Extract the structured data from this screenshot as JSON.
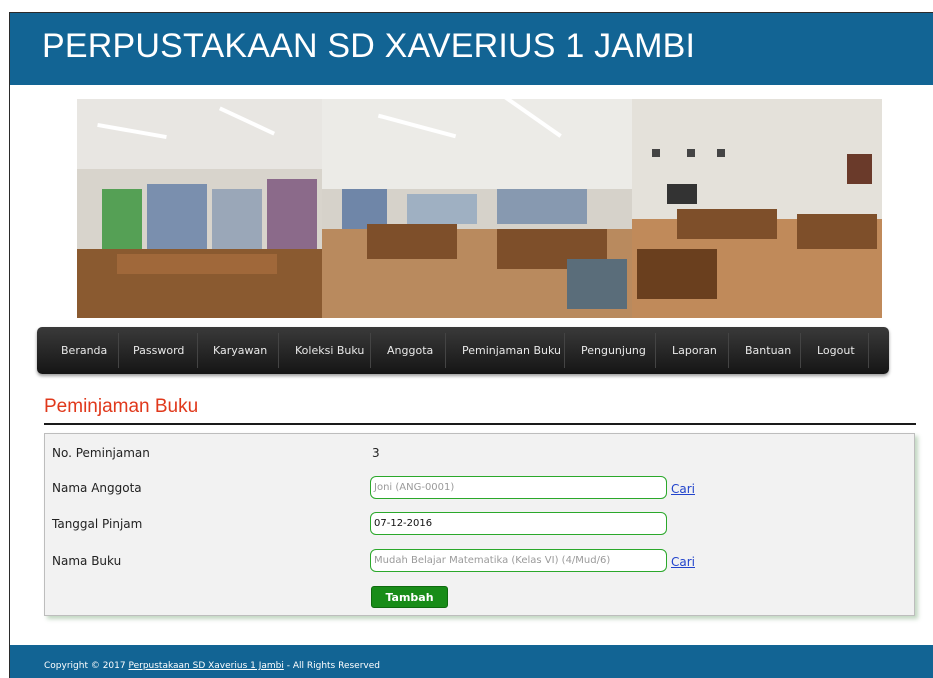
{
  "header": {
    "title": "PERPUSTAKAAN SD XAVERIUS 1 JAMBI"
  },
  "nav": {
    "items": [
      "Beranda",
      "Password",
      "Karyawan",
      "Koleksi Buku",
      "Anggota",
      "Peminjaman Buku",
      "Pengunjung",
      "Laporan",
      "Bantuan",
      "Logout"
    ]
  },
  "page": {
    "heading": "Peminjaman Buku"
  },
  "form": {
    "no_peminjaman_label": "No. Peminjaman",
    "no_peminjaman_value": "3",
    "nama_anggota_label": "Nama Anggota",
    "nama_anggota_value": "Joni (ANG-0001)",
    "tanggal_pinjam_label": "Tanggal Pinjam",
    "tanggal_pinjam_value": "07-12-2016",
    "nama_buku_label": "Nama Buku",
    "nama_buku_value": "Mudah Belajar Matematika (Kelas VI) (4/Mud/6)",
    "cari_label": "Cari",
    "submit_label": "Tambah"
  },
  "footer": {
    "prefix": "Copyright © 2017 ",
    "link": "Perpustakaan SD Xaverius 1 Jambi",
    "suffix": " - All Rights Reserved"
  },
  "colors": {
    "brand": "#126494",
    "heading": "#e0381b",
    "button": "#188c18",
    "field_border": "#2ba82b"
  }
}
